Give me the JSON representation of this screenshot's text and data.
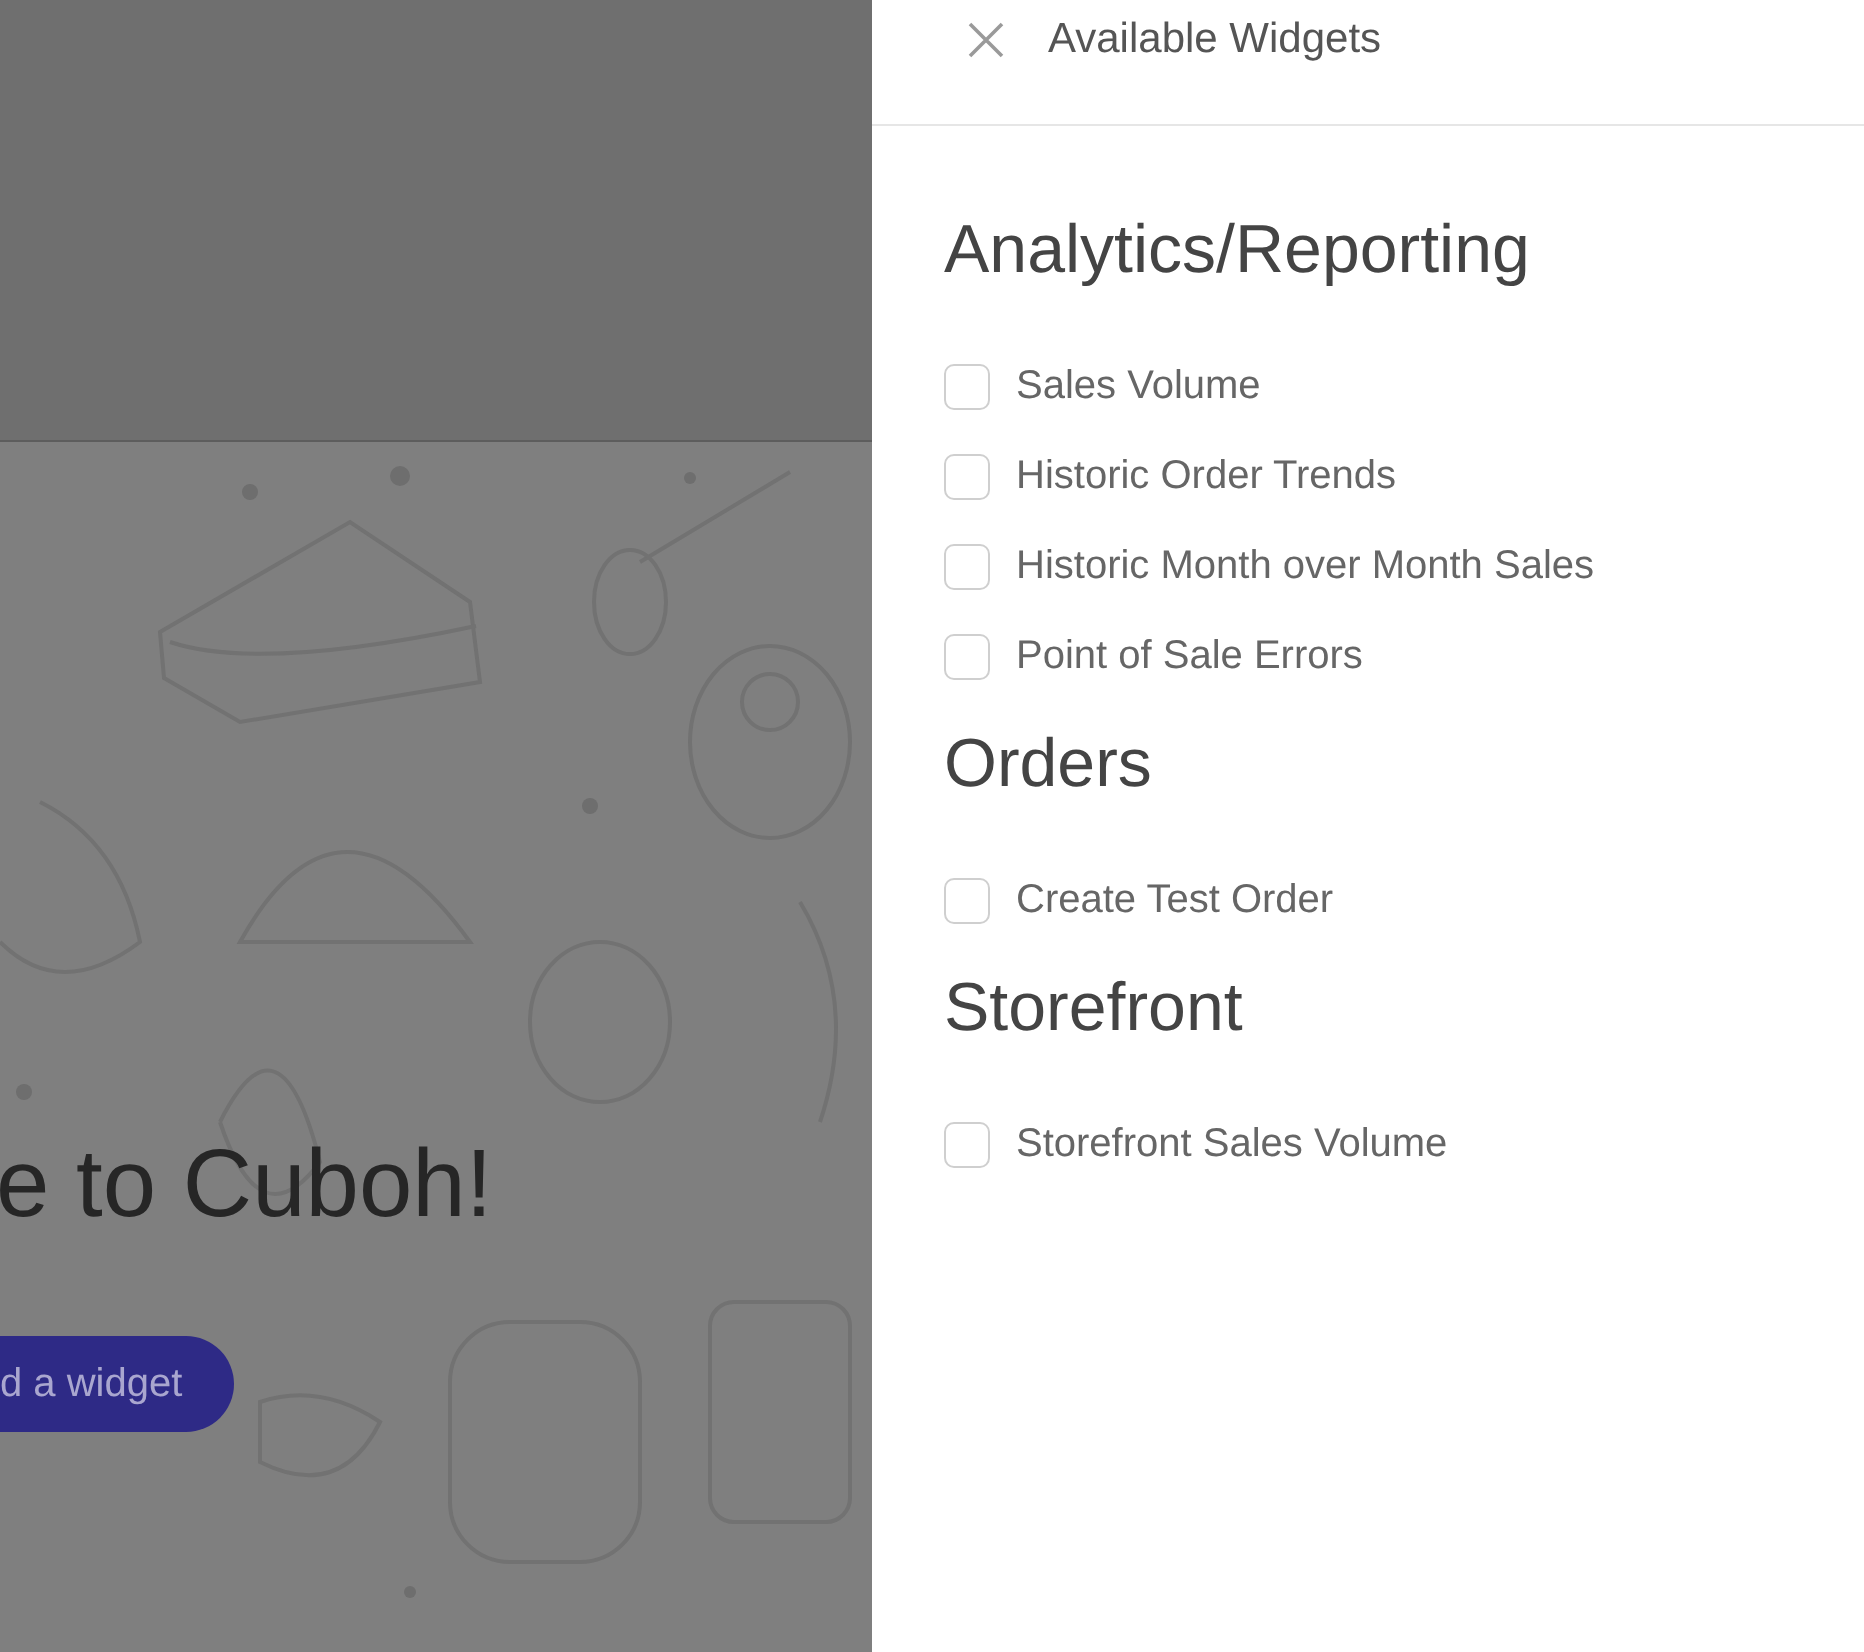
{
  "background_page": {
    "heading": "e to Cuboh!",
    "button": "d a widget"
  },
  "panel": {
    "title": "Available Widgets",
    "sections": [
      {
        "title": "Analytics/Reporting",
        "widgets": [
          {
            "label": "Sales Volume",
            "checked": false
          },
          {
            "label": "Historic Order Trends",
            "checked": false
          },
          {
            "label": "Historic Month over Month Sales",
            "checked": false
          },
          {
            "label": "Point of Sale Errors",
            "checked": false
          }
        ]
      },
      {
        "title": "Orders",
        "widgets": [
          {
            "label": "Create Test Order",
            "checked": false
          }
        ]
      },
      {
        "title": "Storefront",
        "widgets": [
          {
            "label": "Storefront Sales Volume",
            "checked": false
          }
        ]
      }
    ]
  }
}
